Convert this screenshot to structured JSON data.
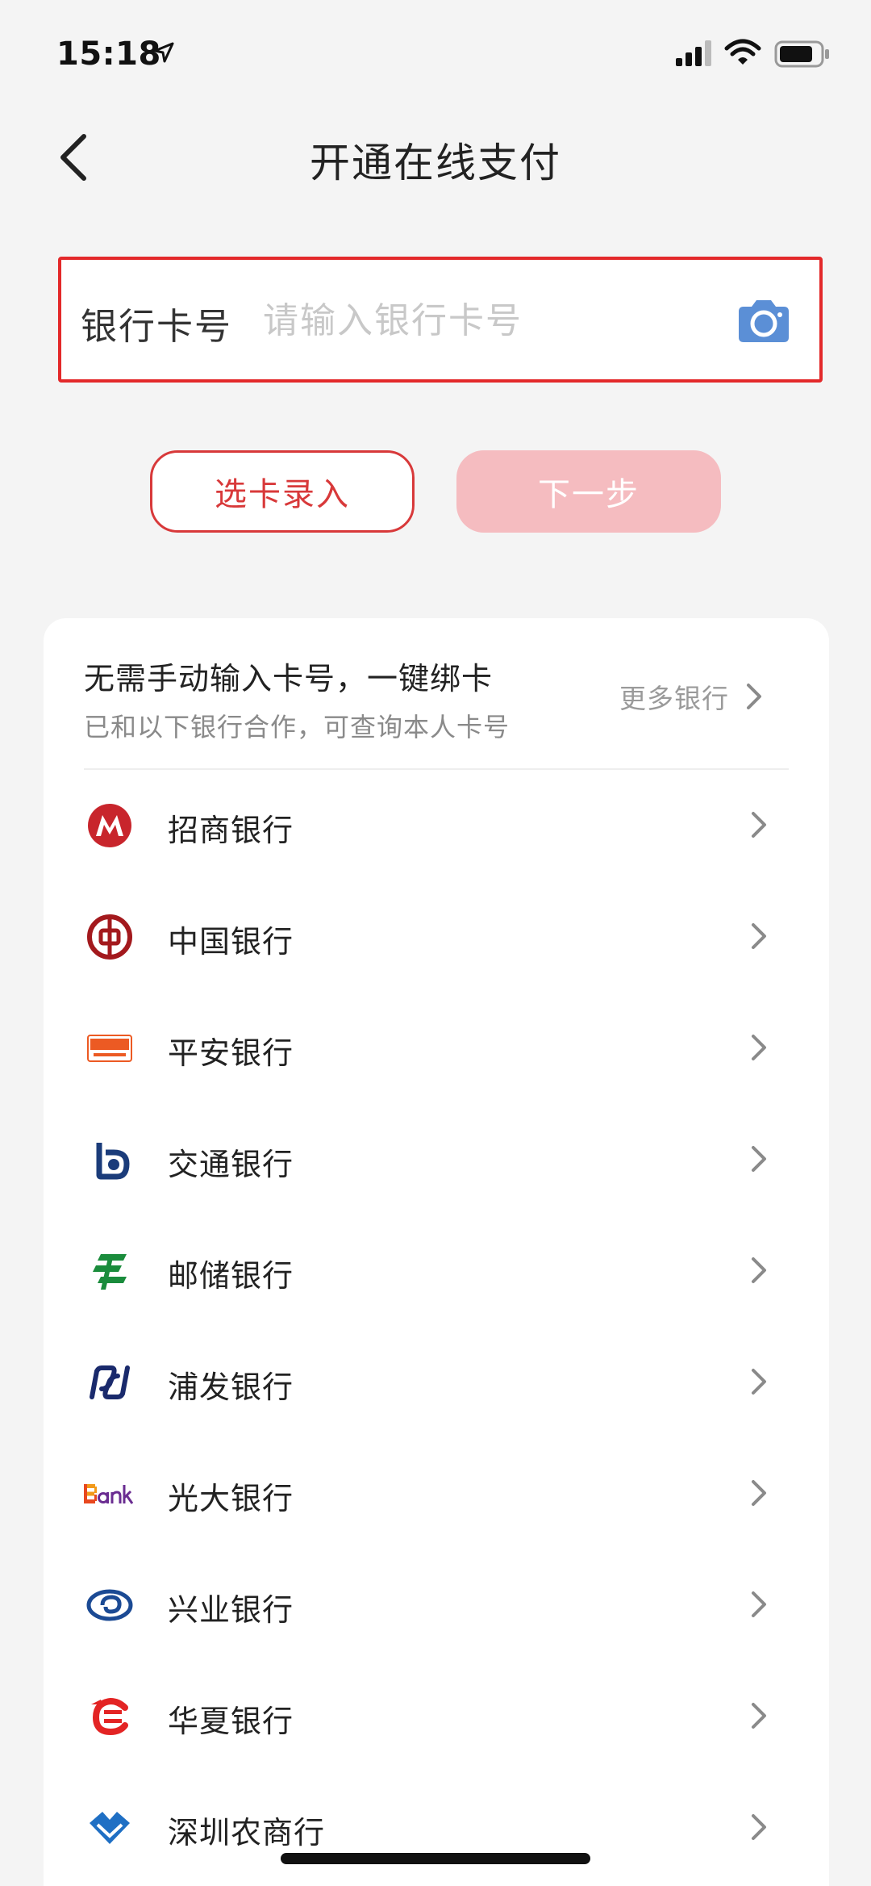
{
  "status_bar": {
    "time": "15:18"
  },
  "nav": {
    "title": "开通在线支付"
  },
  "card_input": {
    "label": "银行卡号",
    "value": "",
    "placeholder": "请输入银行卡号"
  },
  "actions": {
    "select_card_label": "选卡录入",
    "next_label": "下一步"
  },
  "bank_panel": {
    "title": "无需手动输入卡号，一键绑卡",
    "subtitle": "已和以下银行合作，可查询本人卡号",
    "more_label": "更多银行",
    "banks": [
      {
        "name": "招商银行",
        "icon": "cmb-logo-icon",
        "color": "#c8252c"
      },
      {
        "name": "中国银行",
        "icon": "boc-logo-icon",
        "color": "#a3191d"
      },
      {
        "name": "平安银行",
        "icon": "pingan-logo-icon",
        "color": "#ec5a23"
      },
      {
        "name": "交通银行",
        "icon": "bocom-logo-icon",
        "color": "#1b3c7a"
      },
      {
        "name": "邮储银行",
        "icon": "psbc-logo-icon",
        "color": "#1a8c3c"
      },
      {
        "name": "浦发银行",
        "icon": "spdb-logo-icon",
        "color": "#1a2a6c"
      },
      {
        "name": "光大银行",
        "icon": "ceb-logo-icon",
        "color": "#6a2c91"
      },
      {
        "name": "兴业银行",
        "icon": "cib-logo-icon",
        "color": "#1b4a94"
      },
      {
        "name": "华夏银行",
        "icon": "hxb-logo-icon",
        "color": "#e32424"
      },
      {
        "name": "深圳农商行",
        "icon": "szrcb-logo-icon",
        "color": "#1f6fc4"
      }
    ]
  },
  "colors": {
    "accent": "#e3292a",
    "next_disabled": "#f5bcc0",
    "camera": "#5b8fd6"
  }
}
